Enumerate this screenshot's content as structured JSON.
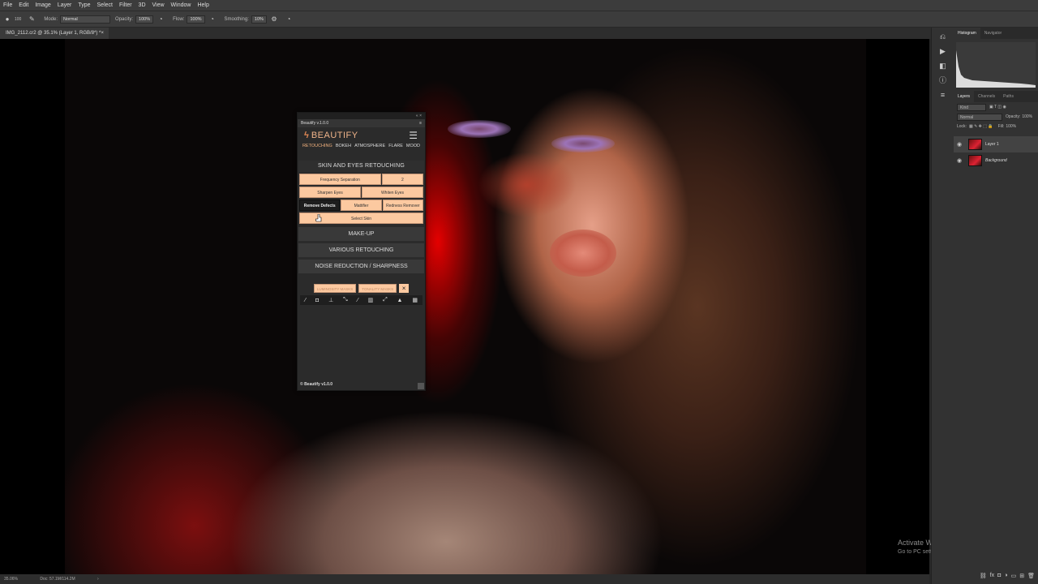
{
  "menubar": {
    "items": [
      "File",
      "Edit",
      "Image",
      "Layer",
      "Type",
      "Select",
      "Filter",
      "3D",
      "View",
      "Window",
      "Help"
    ]
  },
  "options_bar": {
    "brush_size": "100",
    "mode_label": "Mode:",
    "mode_value": "Normal",
    "opacity_label": "Opacity:",
    "opacity_value": "100%",
    "flow_label": "Flow:",
    "flow_value": "100%",
    "smoothing_label": "Smoothing:",
    "smoothing_value": "10%"
  },
  "document": {
    "tab_title": "IMG_2112.cr2 @ 35.1% (Layer 1, RGB/8*) *",
    "close_glyph": "×"
  },
  "status_bar": {
    "zoom": "35.06%",
    "doc": "Doc: 57.1M/114.2M"
  },
  "watermark": {
    "title": "Activate Windows",
    "subtitle": "Go to PC settings to activate Windows."
  },
  "right_panel": {
    "top_tabs": [
      "Histogram",
      "Navigator"
    ],
    "layer_tabs": [
      "Layers",
      "Channels",
      "Paths"
    ],
    "kind_label": "Kind",
    "blend_mode": "Normal",
    "opacity_label": "Opacity:",
    "opacity_value": "100%",
    "lock_label": "Lock:",
    "fill_label": "Fill:",
    "fill_value": "100%",
    "layers": [
      {
        "name": "Layer 1",
        "active": true
      },
      {
        "name": "Background",
        "active": false
      }
    ]
  },
  "beautify": {
    "window_title": "Beautify v.1.0.0",
    "logo_text": "BEAUTIFY",
    "nav": [
      "RETOUCHING",
      "BOKEH",
      "ATMOSPHERE",
      "FLARE",
      "MOOD"
    ],
    "active_nav": "RETOUCHING",
    "open_section": "SKIN AND EYES RETOUCHING",
    "buttons": {
      "frequency_separation": "Frequency Separation",
      "frequency_value": "2",
      "sharpen_eyes": "Sharpen Eyes",
      "whiten_eyes": "Whiten Eyes",
      "remove_defects": "Remove Defects",
      "mattifier": "Mattifier",
      "redness_remover": "Redness Remover",
      "select_skin": "Select Skin"
    },
    "sections": [
      "MAKE-UP",
      "VARIOUS RETOUCHING",
      "NOISE REDUCTION / SHARPNESS"
    ],
    "masks": [
      "LUMINOSITY MASKS",
      "TONALITY MASKS"
    ],
    "mask_close": "×",
    "footer": "© Beautify v1.0.0"
  }
}
